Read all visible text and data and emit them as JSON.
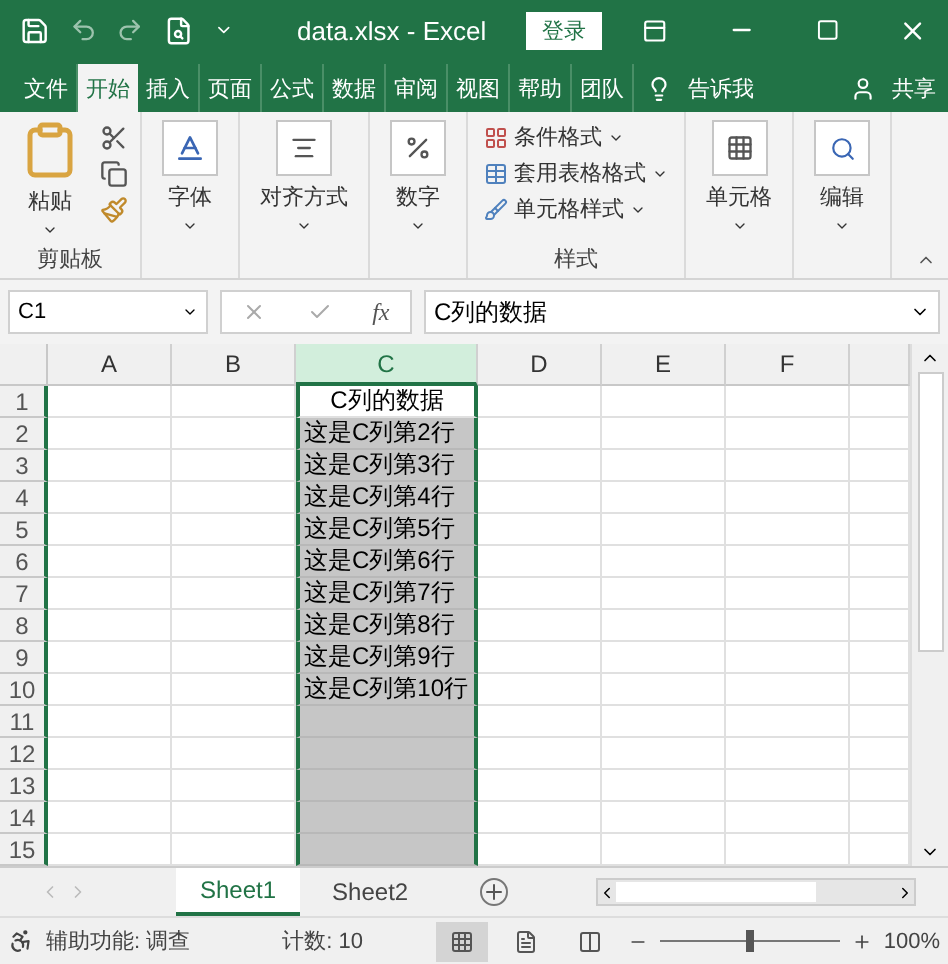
{
  "title_bar": {
    "title": "data.xlsx - Excel",
    "login": "登录"
  },
  "menu_tabs": [
    {
      "label": "文件",
      "selected": false
    },
    {
      "label": "开始",
      "selected": true
    },
    {
      "label": "插入",
      "selected": false
    },
    {
      "label": "页面",
      "selected": false
    },
    {
      "label": "公式",
      "selected": false
    },
    {
      "label": "数据",
      "selected": false
    },
    {
      "label": "审阅",
      "selected": false
    },
    {
      "label": "视图",
      "selected": false
    },
    {
      "label": "帮助",
      "selected": false
    },
    {
      "label": "团队",
      "selected": false
    }
  ],
  "tell_me": "告诉我",
  "share": "共享",
  "ribbon": {
    "paste": "粘贴",
    "clipboard_label": "剪贴板",
    "font": "字体",
    "alignment": "对齐方式",
    "number": "数字",
    "styles": [
      "条件格式",
      "套用表格格式",
      "单元格样式"
    ],
    "styles_label": "样式",
    "cells": "单元格",
    "editing": "编辑"
  },
  "formula_bar": {
    "name_box": "C1",
    "fx": "fx",
    "value": "C列的数据"
  },
  "columns": [
    {
      "label": "A",
      "selected": false
    },
    {
      "label": "B",
      "selected": false
    },
    {
      "label": "C",
      "selected": true
    },
    {
      "label": "D",
      "selected": false
    },
    {
      "label": "E",
      "selected": false
    },
    {
      "label": "F",
      "selected": false
    }
  ],
  "rows": [
    {
      "label": "1",
      "value": "C列的数据",
      "active": true
    },
    {
      "label": "2",
      "value": "这是C列第2行",
      "active": false
    },
    {
      "label": "3",
      "value": "这是C列第3行",
      "active": false
    },
    {
      "label": "4",
      "value": "这是C列第4行",
      "active": false
    },
    {
      "label": "5",
      "value": "这是C列第5行",
      "active": false
    },
    {
      "label": "6",
      "value": "这是C列第6行",
      "active": false
    },
    {
      "label": "7",
      "value": "这是C列第7行",
      "active": false
    },
    {
      "label": "8",
      "value": "这是C列第8行",
      "active": false
    },
    {
      "label": "9",
      "value": "这是C列第9行",
      "active": false
    },
    {
      "label": "10",
      "value": "这是C列第10行",
      "active": false
    },
    {
      "label": "11",
      "active": false
    },
    {
      "label": "12",
      "active": false
    },
    {
      "label": "13",
      "active": false
    },
    {
      "label": "14",
      "active": false
    },
    {
      "label": "15",
      "active": false
    }
  ],
  "sheets": [
    {
      "label": "Sheet1",
      "selected": true
    },
    {
      "label": "Sheet2",
      "selected": false
    }
  ],
  "status_bar": {
    "accessibility": "辅助功能: 调查",
    "count": "计数: 10",
    "views": [
      {
        "kind": "normal",
        "selected": true
      },
      {
        "kind": "layout",
        "selected": false
      },
      {
        "kind": "pagebreak",
        "selected": false
      }
    ],
    "zoom": {
      "level": 0.5
    },
    "zoom_text": "100%"
  }
}
